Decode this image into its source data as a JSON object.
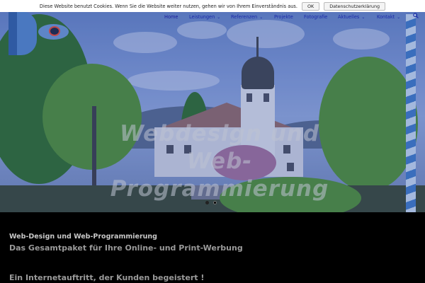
{
  "cookie_bar": {
    "message": "Diese Website benutzt Cookies. Wenn Sie die Website weiter nutzen, gehen wir von Ihrem Einverständnis aus.",
    "ok_label": "OK",
    "privacy_label": "Datenschutzerklärung"
  },
  "nav": {
    "items": [
      {
        "label": "Home",
        "active": true
      },
      {
        "label": "Leistungen",
        "has_dropdown": true
      },
      {
        "label": "Referenzen",
        "has_dropdown": true
      },
      {
        "label": "Projekte"
      },
      {
        "label": "Fotografie"
      },
      {
        "label": "Aktuelles",
        "has_dropdown": true
      },
      {
        "label": "Kontakt",
        "has_dropdown": true
      }
    ],
    "chevron_glyph": "⌄",
    "search_icon": "search-icon"
  },
  "hero": {
    "overlay_line1": "Webdesign und",
    "overlay_line2": "Web-",
    "overlay_line3": "Programmierung",
    "slider_dots": 2,
    "active_dot": 2
  },
  "content": {
    "heading": "Web-Design und Web-Programmierung",
    "subheading": "Das Gesamtpaket für Ihre Online- und Print-Werbung",
    "tagline": "Ein Internetauftritt, der Kunden begeistert !"
  },
  "colors": {
    "nav_link": "#1c2aa8",
    "background": "#000000",
    "logo_blue": "#4a78c0"
  }
}
